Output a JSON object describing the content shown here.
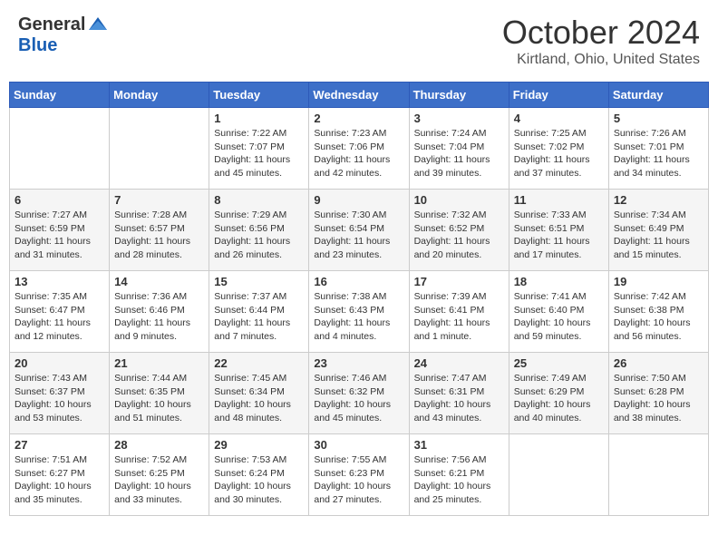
{
  "header": {
    "logo_general": "General",
    "logo_blue": "Blue",
    "month_title": "October 2024",
    "location": "Kirtland, Ohio, United States"
  },
  "days_of_week": [
    "Sunday",
    "Monday",
    "Tuesday",
    "Wednesday",
    "Thursday",
    "Friday",
    "Saturday"
  ],
  "weeks": [
    [
      {
        "day": "",
        "info": ""
      },
      {
        "day": "",
        "info": ""
      },
      {
        "day": "1",
        "info": "Sunrise: 7:22 AM\nSunset: 7:07 PM\nDaylight: 11 hours and 45 minutes."
      },
      {
        "day": "2",
        "info": "Sunrise: 7:23 AM\nSunset: 7:06 PM\nDaylight: 11 hours and 42 minutes."
      },
      {
        "day": "3",
        "info": "Sunrise: 7:24 AM\nSunset: 7:04 PM\nDaylight: 11 hours and 39 minutes."
      },
      {
        "day": "4",
        "info": "Sunrise: 7:25 AM\nSunset: 7:02 PM\nDaylight: 11 hours and 37 minutes."
      },
      {
        "day": "5",
        "info": "Sunrise: 7:26 AM\nSunset: 7:01 PM\nDaylight: 11 hours and 34 minutes."
      }
    ],
    [
      {
        "day": "6",
        "info": "Sunrise: 7:27 AM\nSunset: 6:59 PM\nDaylight: 11 hours and 31 minutes."
      },
      {
        "day": "7",
        "info": "Sunrise: 7:28 AM\nSunset: 6:57 PM\nDaylight: 11 hours and 28 minutes."
      },
      {
        "day": "8",
        "info": "Sunrise: 7:29 AM\nSunset: 6:56 PM\nDaylight: 11 hours and 26 minutes."
      },
      {
        "day": "9",
        "info": "Sunrise: 7:30 AM\nSunset: 6:54 PM\nDaylight: 11 hours and 23 minutes."
      },
      {
        "day": "10",
        "info": "Sunrise: 7:32 AM\nSunset: 6:52 PM\nDaylight: 11 hours and 20 minutes."
      },
      {
        "day": "11",
        "info": "Sunrise: 7:33 AM\nSunset: 6:51 PM\nDaylight: 11 hours and 17 minutes."
      },
      {
        "day": "12",
        "info": "Sunrise: 7:34 AM\nSunset: 6:49 PM\nDaylight: 11 hours and 15 minutes."
      }
    ],
    [
      {
        "day": "13",
        "info": "Sunrise: 7:35 AM\nSunset: 6:47 PM\nDaylight: 11 hours and 12 minutes."
      },
      {
        "day": "14",
        "info": "Sunrise: 7:36 AM\nSunset: 6:46 PM\nDaylight: 11 hours and 9 minutes."
      },
      {
        "day": "15",
        "info": "Sunrise: 7:37 AM\nSunset: 6:44 PM\nDaylight: 11 hours and 7 minutes."
      },
      {
        "day": "16",
        "info": "Sunrise: 7:38 AM\nSunset: 6:43 PM\nDaylight: 11 hours and 4 minutes."
      },
      {
        "day": "17",
        "info": "Sunrise: 7:39 AM\nSunset: 6:41 PM\nDaylight: 11 hours and 1 minute."
      },
      {
        "day": "18",
        "info": "Sunrise: 7:41 AM\nSunset: 6:40 PM\nDaylight: 10 hours and 59 minutes."
      },
      {
        "day": "19",
        "info": "Sunrise: 7:42 AM\nSunset: 6:38 PM\nDaylight: 10 hours and 56 minutes."
      }
    ],
    [
      {
        "day": "20",
        "info": "Sunrise: 7:43 AM\nSunset: 6:37 PM\nDaylight: 10 hours and 53 minutes."
      },
      {
        "day": "21",
        "info": "Sunrise: 7:44 AM\nSunset: 6:35 PM\nDaylight: 10 hours and 51 minutes."
      },
      {
        "day": "22",
        "info": "Sunrise: 7:45 AM\nSunset: 6:34 PM\nDaylight: 10 hours and 48 minutes."
      },
      {
        "day": "23",
        "info": "Sunrise: 7:46 AM\nSunset: 6:32 PM\nDaylight: 10 hours and 45 minutes."
      },
      {
        "day": "24",
        "info": "Sunrise: 7:47 AM\nSunset: 6:31 PM\nDaylight: 10 hours and 43 minutes."
      },
      {
        "day": "25",
        "info": "Sunrise: 7:49 AM\nSunset: 6:29 PM\nDaylight: 10 hours and 40 minutes."
      },
      {
        "day": "26",
        "info": "Sunrise: 7:50 AM\nSunset: 6:28 PM\nDaylight: 10 hours and 38 minutes."
      }
    ],
    [
      {
        "day": "27",
        "info": "Sunrise: 7:51 AM\nSunset: 6:27 PM\nDaylight: 10 hours and 35 minutes."
      },
      {
        "day": "28",
        "info": "Sunrise: 7:52 AM\nSunset: 6:25 PM\nDaylight: 10 hours and 33 minutes."
      },
      {
        "day": "29",
        "info": "Sunrise: 7:53 AM\nSunset: 6:24 PM\nDaylight: 10 hours and 30 minutes."
      },
      {
        "day": "30",
        "info": "Sunrise: 7:55 AM\nSunset: 6:23 PM\nDaylight: 10 hours and 27 minutes."
      },
      {
        "day": "31",
        "info": "Sunrise: 7:56 AM\nSunset: 6:21 PM\nDaylight: 10 hours and 25 minutes."
      },
      {
        "day": "",
        "info": ""
      },
      {
        "day": "",
        "info": ""
      }
    ]
  ]
}
